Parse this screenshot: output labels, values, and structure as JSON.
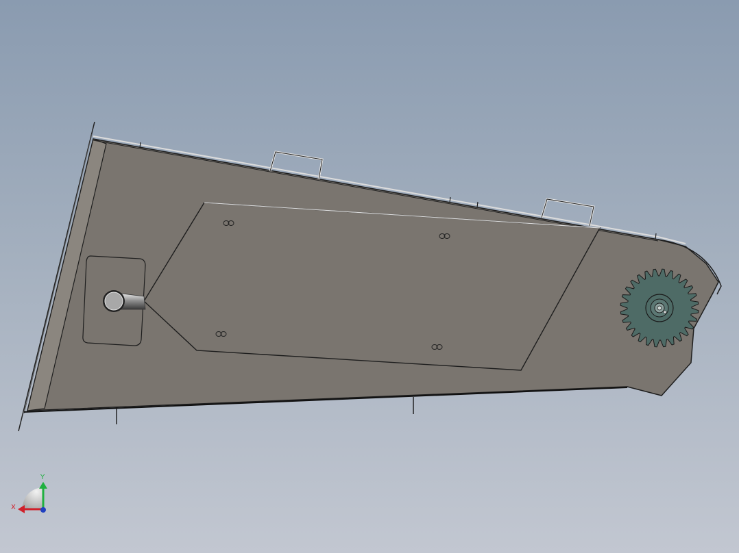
{
  "triad": {
    "x_label": "X",
    "y_label": "Y",
    "x_color": "#d0202a",
    "y_color": "#20b040",
    "z_color": "#2040c0"
  },
  "colors": {
    "background_top": "#8a9bb0",
    "background_bottom": "#c2c7d1",
    "panel_fill": "#7a756f",
    "edge": "#1e1e1e",
    "sprocket_fill": "#4e6b66"
  },
  "icons": [
    "sprocket-icon",
    "triad-icon"
  ]
}
